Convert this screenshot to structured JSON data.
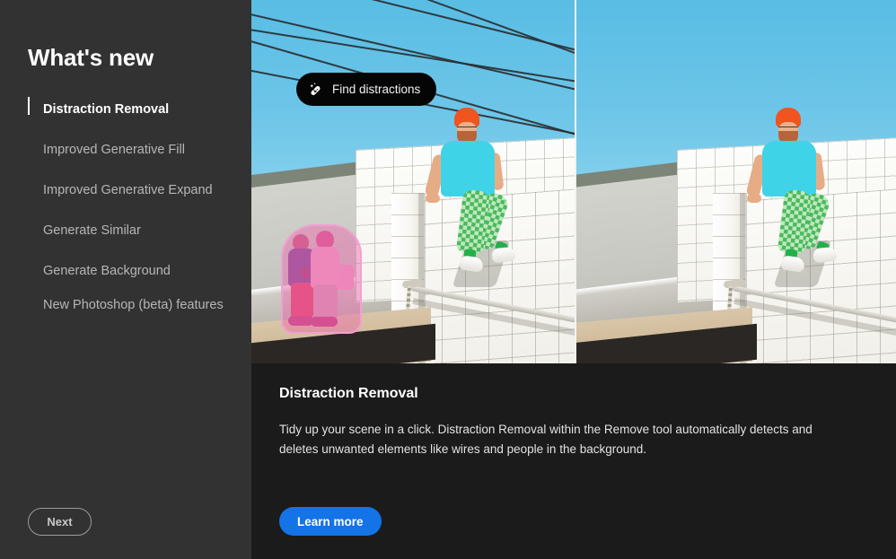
{
  "sidebar": {
    "title": "What's new",
    "items": [
      {
        "label": "Distraction Removal",
        "active": true
      },
      {
        "label": "Improved Generative Fill",
        "active": false
      },
      {
        "label": "Improved Generative Expand",
        "active": false
      },
      {
        "label": "Generate Similar",
        "active": false
      },
      {
        "label": "Generate Background",
        "active": false
      },
      {
        "label": "New Photoshop (beta) features",
        "active": false
      }
    ],
    "next_label": "Next"
  },
  "media": {
    "overlay_button": {
      "label": "Find distractions",
      "icon": "healing-brush-icon"
    },
    "before_pane_name": "before-image",
    "after_pane_name": "after-image"
  },
  "info": {
    "title": "Distraction Removal",
    "description": "Tidy up your scene in a click. Distraction Removal within the Remove tool automatically detects and deletes unwanted elements like wires and people in the background.",
    "learn_more_label": "Learn more"
  },
  "colors": {
    "sidebar_bg": "#323232",
    "content_bg": "#1b1b1b",
    "accent_blue": "#1473e6",
    "pill_black": "#050505",
    "active_text": "#ffffff",
    "muted_text": "#b6b6b6",
    "selection_pink": "#ea5aaa",
    "sky_blue": "#6ec6e8"
  }
}
